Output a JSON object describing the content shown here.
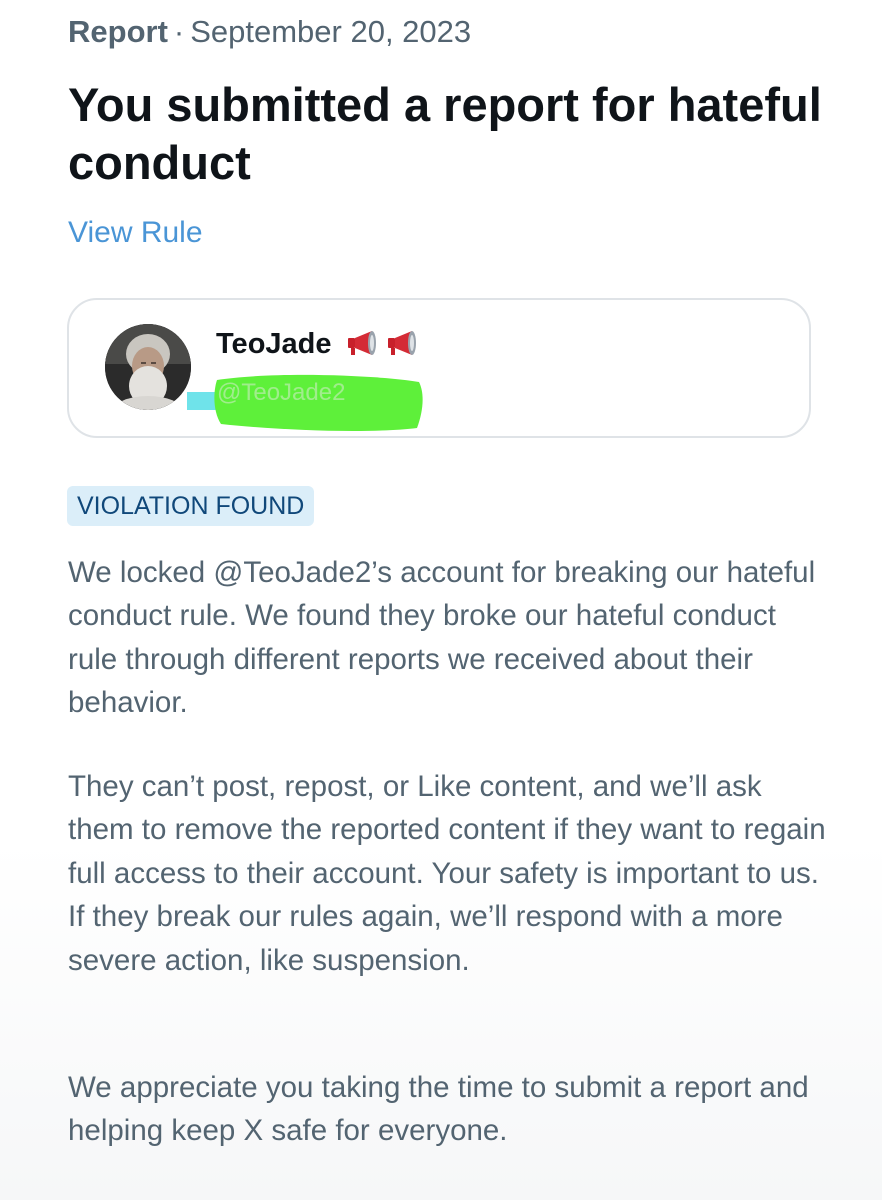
{
  "header": {
    "report_label": "Report",
    "separator": "·",
    "date": "September 20, 2023"
  },
  "title": "You submitted a report for hateful conduct",
  "view_rule_link": "View Rule",
  "reported_user": {
    "display_name": "TeoJade",
    "handle": "@TeoJade2",
    "name_icons": [
      "megaphone-icon",
      "megaphone-icon"
    ],
    "handle_redaction_color": "#5ef03a"
  },
  "status_badge": "VIOLATION FOUND",
  "body": {
    "paragraph_1": "We locked @TeoJade2’s account for breaking our hateful conduct rule. We found they broke our hateful conduct rule through different reports we received about their behavior.",
    "paragraph_2": "They can’t post, repost, or Like content, and we’ll ask them to remove the reported content if they want to regain full access to their account. Your safety is important to us. If they break our rules again, we’ll respond with a more severe action, like suspension.",
    "paragraph_3": "We appreciate you taking the time to submit a report and helping keep X safe for everyone."
  },
  "colors": {
    "link": "#4a95d6",
    "badge_bg": "#dbeef9",
    "badge_text": "#10487a",
    "secondary_text": "#536471",
    "primary_text": "#0f1419"
  }
}
